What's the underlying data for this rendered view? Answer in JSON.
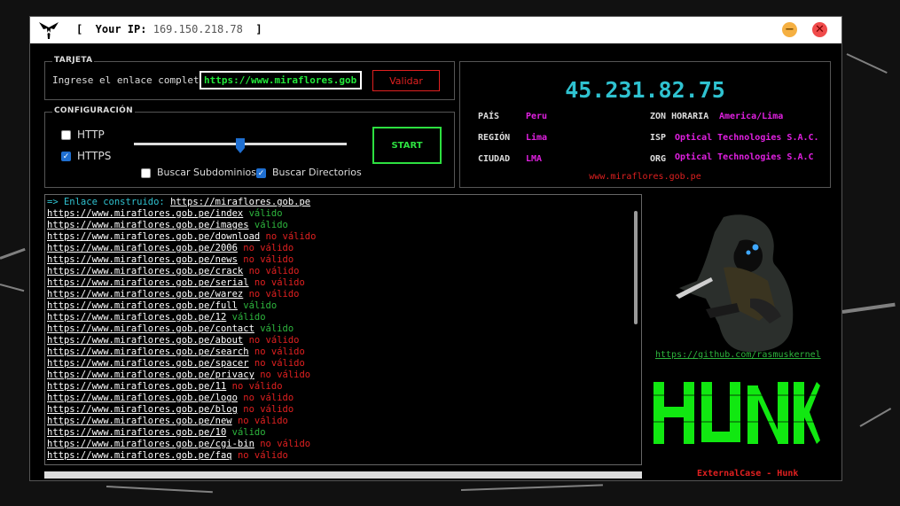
{
  "titlebar": {
    "ip_prefix": "[  Your IP:",
    "ip_value": "169.150.218.78",
    "ip_suffix": "]",
    "minimize_glyph": "−",
    "close_glyph": "✕"
  },
  "target": {
    "legend": "TARJETA",
    "prompt": "Ingrese el enlace completo",
    "url_value": "https://www.miraflores.gob.pe",
    "validate_label": "Validar"
  },
  "config": {
    "legend": "CONFIGURACIÓN",
    "http_label": "HTTP",
    "http_checked": false,
    "https_label": "HTTPS",
    "https_checked": true,
    "subdomains_label": "Buscar Subdominios",
    "subdomains_checked": false,
    "directories_label": "Buscar Directorios",
    "directories_checked": true,
    "slider_value": 0.5,
    "start_label": "START"
  },
  "info": {
    "ip": "45.231.82.75",
    "pais_k": "PAÍS",
    "pais_v": "Peru",
    "region_k": "REGIÓN",
    "region_v": "Lima",
    "ciudad_k": "CIUDAD",
    "ciudad_v": "LMA",
    "zona_k": "ZON HORARIA",
    "zona_v": "America/Lima",
    "isp_k": "ISP",
    "isp_v": "Optical Technologies S.A.C.",
    "org_k": "ORG",
    "org_v": "Optical Technologies S.A.C",
    "url": "www.miraflores.gob.pe"
  },
  "console": {
    "header_prefix": "=> Enlace construido:",
    "header_url": "https://miraflores.gob.pe",
    "lines": [
      {
        "url": "https://www.miraflores.gob.pe/index",
        "status": "válido",
        "ok": true
      },
      {
        "url": "https://www.miraflores.gob.pe/images",
        "status": "válido",
        "ok": true
      },
      {
        "url": "https://www.miraflores.gob.pe/download",
        "status": "no válido",
        "ok": false
      },
      {
        "url": "https://www.miraflores.gob.pe/2006",
        "status": "no válido",
        "ok": false
      },
      {
        "url": "https://www.miraflores.gob.pe/news",
        "status": "no válido",
        "ok": false
      },
      {
        "url": "https://www.miraflores.gob.pe/crack",
        "status": "no válido",
        "ok": false
      },
      {
        "url": "https://www.miraflores.gob.pe/serial",
        "status": "no válido",
        "ok": false
      },
      {
        "url": "https://www.miraflores.gob.pe/warez",
        "status": "no válido",
        "ok": false
      },
      {
        "url": "https://www.miraflores.gob.pe/full",
        "status": "válido",
        "ok": true
      },
      {
        "url": "https://www.miraflores.gob.pe/12",
        "status": "válido",
        "ok": true
      },
      {
        "url": "https://www.miraflores.gob.pe/contact",
        "status": "válido",
        "ok": true
      },
      {
        "url": "https://www.miraflores.gob.pe/about",
        "status": "no válido",
        "ok": false
      },
      {
        "url": "https://www.miraflores.gob.pe/search",
        "status": "no válido",
        "ok": false
      },
      {
        "url": "https://www.miraflores.gob.pe/spacer",
        "status": "no válido",
        "ok": false
      },
      {
        "url": "https://www.miraflores.gob.pe/privacy",
        "status": "no válido",
        "ok": false
      },
      {
        "url": "https://www.miraflores.gob.pe/11",
        "status": "no válido",
        "ok": false
      },
      {
        "url": "https://www.miraflores.gob.pe/logo",
        "status": "no válido",
        "ok": false
      },
      {
        "url": "https://www.miraflores.gob.pe/blog",
        "status": "no válido",
        "ok": false
      },
      {
        "url": "https://www.miraflores.gob.pe/new",
        "status": "no válido",
        "ok": false
      },
      {
        "url": "https://www.miraflores.gob.pe/10",
        "status": "válido",
        "ok": true
      },
      {
        "url": "https://www.miraflores.gob.pe/cgi-bin",
        "status": "no válido",
        "ok": false
      },
      {
        "url": "https://www.miraflores.gob.pe/faq",
        "status": "no válido",
        "ok": false
      }
    ]
  },
  "side": {
    "github_link": "https://github.com/rasmuskernel",
    "logo_text": "HUNK",
    "footer": "ExternalCase - Hunk"
  },
  "colors": {
    "accent_green": "#2de040",
    "accent_red": "#e02020",
    "accent_cyan": "#2fc2d0",
    "accent_magenta": "#e020e0"
  },
  "icons": {
    "app_logo": "hunk-emblem-icon",
    "minimize": "minimize-icon",
    "close": "close-icon",
    "check": "checkmark-icon"
  }
}
